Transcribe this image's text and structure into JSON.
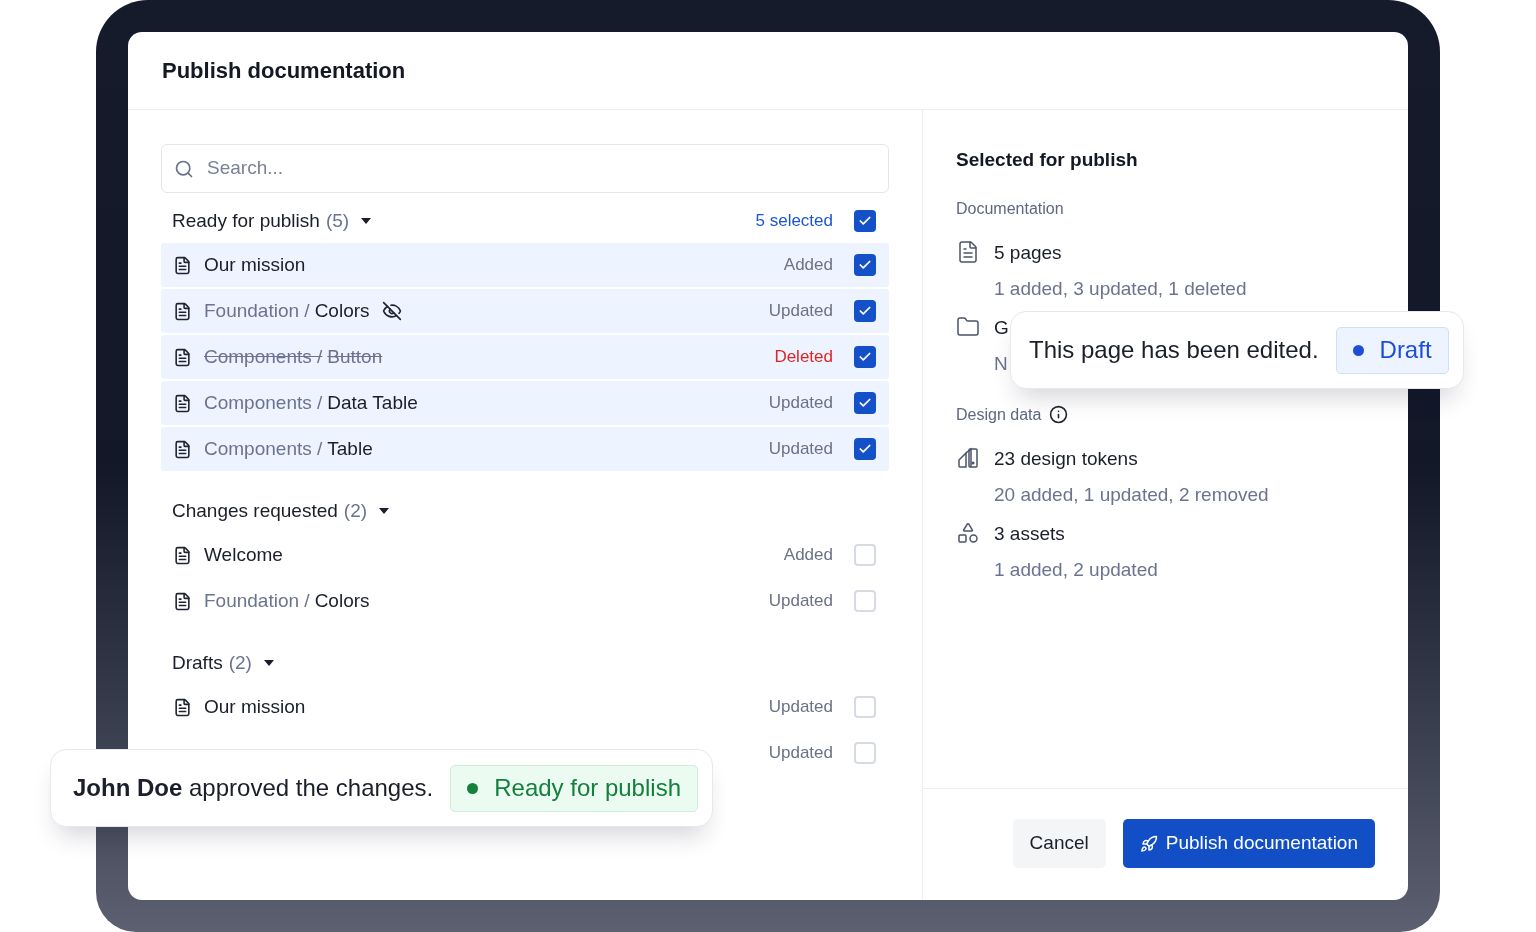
{
  "dialog": {
    "title": "Publish documentation"
  },
  "search": {
    "placeholder": "Search..."
  },
  "groups": [
    {
      "title": "Ready for publish",
      "count": "(5)",
      "expanded": true,
      "selected_label": "5 selected",
      "checked": true,
      "items": [
        {
          "name": "Our mission",
          "status": "Added",
          "kind": "normal",
          "hidden": false,
          "checked": true
        },
        {
          "path": "Foundation /",
          "name": "Colors",
          "status": "Updated",
          "kind": "normal",
          "hidden": true,
          "checked": true
        },
        {
          "path": "Components /",
          "name": "Button",
          "status": "Deleted",
          "kind": "deleted",
          "hidden": false,
          "checked": true
        },
        {
          "path": "Components /",
          "name": "Data Table",
          "status": "Updated",
          "kind": "normal",
          "hidden": false,
          "checked": true
        },
        {
          "path": "Components /",
          "name": "Table",
          "status": "Updated",
          "kind": "normal",
          "hidden": false,
          "checked": true
        }
      ]
    },
    {
      "title": "Changes requested",
      "count": "(2)",
      "expanded": true,
      "items": [
        {
          "name": "Welcome",
          "status": "Added",
          "kind": "normal",
          "hidden": false,
          "checked": false
        },
        {
          "path": "Foundation /",
          "name": "Colors",
          "status": "Updated",
          "kind": "normal",
          "hidden": false,
          "checked": false
        }
      ]
    },
    {
      "title": "Drafts",
      "count": "(2)",
      "expanded": true,
      "items": [
        {
          "name": "Our mission",
          "status": "Updated",
          "kind": "normal",
          "hidden": false,
          "checked": false
        },
        {
          "status": "Updated",
          "kind": "covered",
          "hidden": false,
          "checked": false
        }
      ]
    }
  ],
  "summary": {
    "title": "Selected for publish",
    "sections": [
      {
        "label": "Documentation",
        "info": false,
        "items": [
          {
            "kind": "page",
            "title": "5 pages",
            "detail": "1 added, 3 updated, 1 deleted"
          },
          {
            "kind": "folder",
            "title": "G",
            "detail": "N"
          }
        ]
      },
      {
        "label": "Design data",
        "info": true,
        "items": [
          {
            "kind": "tokens",
            "title": "23 design tokens",
            "detail": "20 added, 1 updated, 2 removed"
          },
          {
            "kind": "assets",
            "title": "3 assets",
            "detail": "1 added, 2 updated"
          }
        ]
      }
    ]
  },
  "buttons": [
    {
      "label": "Cancel",
      "kind": "secondary"
    },
    {
      "label": "Publish documentation",
      "kind": "primary"
    }
  ],
  "toasts": [
    {
      "text": "**John Doe** approved the changes.",
      "badge": "Ready for publish",
      "color": "#15803d"
    },
    {
      "text": "This page has been edited.",
      "badge": "Draft",
      "color": "#1d4ed8"
    }
  ]
}
